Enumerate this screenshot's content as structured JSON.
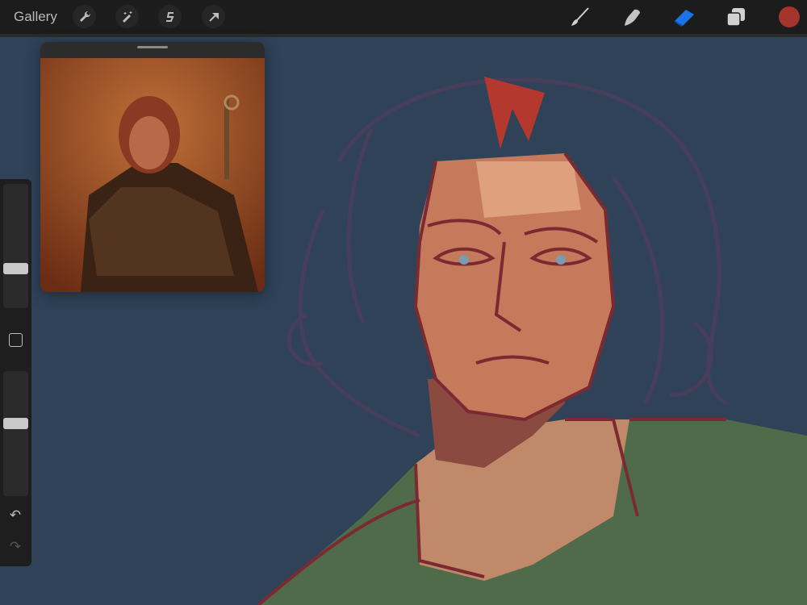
{
  "topbar": {
    "gallery_label": "Gallery",
    "left_tools": [
      "wrench-icon",
      "magic-wand-icon",
      "selection-icon",
      "transform-arrow-icon"
    ],
    "right_tools": [
      "brush-icon",
      "smudge-icon",
      "eraser-icon",
      "layers-icon"
    ],
    "active_tool": "eraser",
    "active_tool_color": "#1a73e8",
    "current_color": "#a5342c"
  },
  "sidebar": {
    "brush_size": 0.3,
    "opacity": 0.59,
    "undo_icon": "↶",
    "redo_icon": "↷"
  },
  "colors": {
    "canvas_bg": "#2f4258",
    "skin": "#c67a5c",
    "line": "#7a2a30",
    "jacket": "#4f6b4a"
  }
}
